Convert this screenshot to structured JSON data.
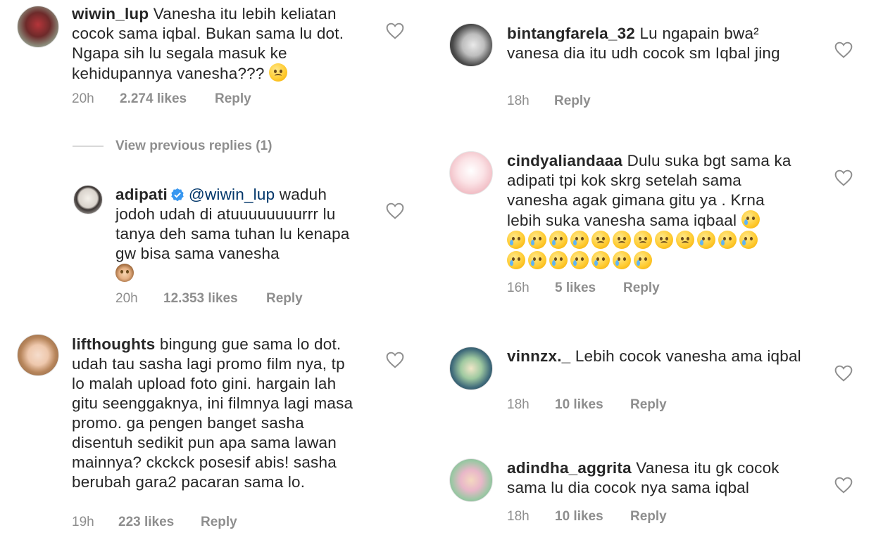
{
  "comments": [
    {
      "username": "wiwin_lup",
      "text": "Vanesha itu lebih keliatan cocok sama iqbal. Bukan sama lu dot. Ngapa sih lu segala masuk ke kehidupannya vanesha???",
      "emoji": "huffing-face",
      "time": "20h",
      "likes": "2.274 likes",
      "reply": "Reply"
    },
    {
      "view_previous": "View previous replies (1)"
    },
    {
      "username": "adipati",
      "verified": true,
      "mention": "@wiwin_lup",
      "text": "waduh jodoh udah di atuuuuuuuurrr lu tanya deh sama tuhan lu kenapa gw bisa sama vanesha",
      "emoji": "see-no-evil-monkey",
      "time": "20h",
      "likes": "12.353 likes",
      "reply": "Reply"
    },
    {
      "username": "lifthoughts",
      "text": "bingung gue sama lo dot. udah tau sasha lagi promo film nya, tp lo malah upload foto gini. hargain lah gitu seenggaknya, ini filmnya lagi masa promo. ga pengen banget sasha disentuh sedikit pun apa sama lawan mainnya? ckckck posesif abis! sasha berubah gara2 pacaran sama lo.",
      "time": "19h",
      "likes": "223 likes",
      "reply": "Reply"
    },
    {
      "username": "bintangfarela_32",
      "text": "Lu ngapain bwa² vanesa dia itu udh cocok sm Iqbal jing",
      "time": "18h",
      "reply": "Reply"
    },
    {
      "username": "cindyaliandaaa",
      "text": "Dulu suka bgt sama ka adipati tpi kok skrg setelah sama vanesha agak gimana gitu ya . Krna lebih suka vanesha sama iqbaal",
      "time": "16h",
      "likes": "5 likes",
      "reply": "Reply"
    },
    {
      "username": "vinnzx._",
      "text": "Lebih cocok vanesha ama iqbal",
      "time": "18h",
      "likes": "10 likes",
      "reply": "Reply"
    },
    {
      "username": "adindha_aggrita",
      "text": "Vanesa itu gk cocok sama lu dia cocok nya sama iqbal",
      "time": "18h",
      "likes": "10 likes",
      "reply": "Reply"
    }
  ],
  "colors": {
    "text": "#262626",
    "meta": "#8e8e8e",
    "verified": "#3897f0",
    "emoji": "#ffcc33"
  }
}
